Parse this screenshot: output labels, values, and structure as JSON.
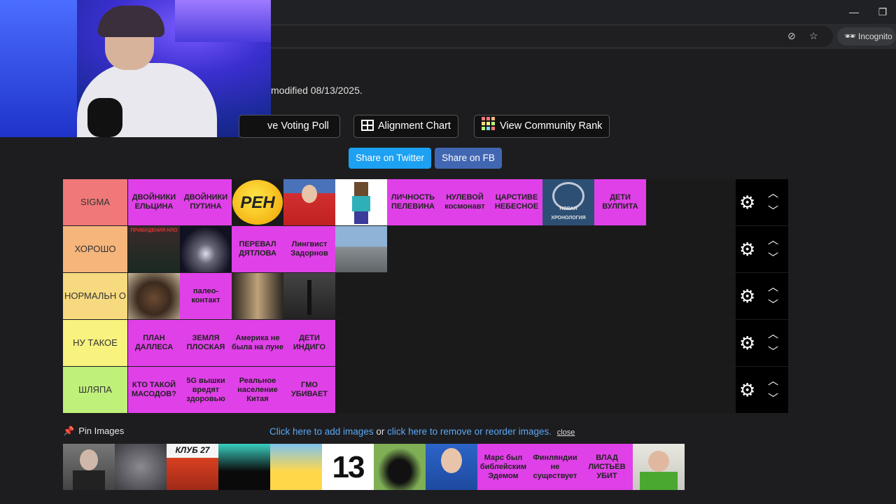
{
  "browser": {
    "incognito_label": "Incognito",
    "minimize_icon": "minimize-icon",
    "restore_icon": "restore-icon"
  },
  "page": {
    "modified_text": "modified 08/13/2025."
  },
  "buttons": {
    "voting_poll": "ve Voting Poll",
    "alignment_chart": "Alignment Chart",
    "community_rank": "View Community Rank",
    "share_twitter": "Share on Twitter",
    "share_fb": "Share on FB"
  },
  "colors": {
    "tile_text_bg": "#e040e8",
    "twitter": "#1da1f2",
    "facebook": "#4267b2",
    "link": "#5aa8f5"
  },
  "tiers": [
    {
      "label": "SIGMA",
      "color": "#f07878"
    },
    {
      "label": "ХОРОШО",
      "color": "#f5b57b"
    },
    {
      "label": "НОРМАЛЬН О",
      "color": "#f7da80"
    },
    {
      "label": "НУ ТАКОЕ",
      "color": "#f8f27e"
    },
    {
      "label": "ШЛЯПА",
      "color": "#bff07a"
    }
  ],
  "tier_items": {
    "sigma": [
      "ДВОЙНИКИ ЕЛЬЦИНА",
      "ДВОЙНИКИ ПУТИНА",
      "РЕН",
      "",
      "",
      "ЛИЧНОСТЬ ПЕЛЕВИНА",
      "НУЛЕВОЙ космонавт",
      "ЦАРСТИВЕ НЕБЕСНОЕ",
      "НОВАЯ ХРОНОЛОГИЯ",
      "ДЕТИ ВУЛПИТА"
    ],
    "horosho": [
      "ПРИВИДЕНИЯ НЛО",
      "",
      "ПЕРЕВАЛ ДЯТЛОВА",
      "Лингвист Задорнов",
      ""
    ],
    "normalno": [
      "",
      "палео-контакт",
      "",
      ""
    ],
    "nu_takoe": [
      "ПЛАН ДАЛЛЕСА",
      "ЗЕМЛЯ ПЛОСКАЯ",
      "Америка не была на луне",
      "ДЕТИ ИНДИГО"
    ],
    "shlyapa": [
      "КТО ТАКОЙ МАСОДОВ?",
      "5G вышки вредят здоровью",
      "Реальное население Китая",
      "ГМО УБИВАЕТ"
    ]
  },
  "pool": {
    "pin_label": "Pin Images",
    "link_add": "Click here to add images",
    "or_text": "or",
    "link_remove": "click here to remove or reorder images.",
    "close": "close",
    "items": [
      "",
      "",
      "КЛУБ 27",
      "",
      "",
      "13",
      "",
      "",
      "Марс был библейским Эдемом",
      "Финляндии не существует",
      "ВЛАД ЛИСТЬЕВ УБИТ",
      ""
    ]
  }
}
